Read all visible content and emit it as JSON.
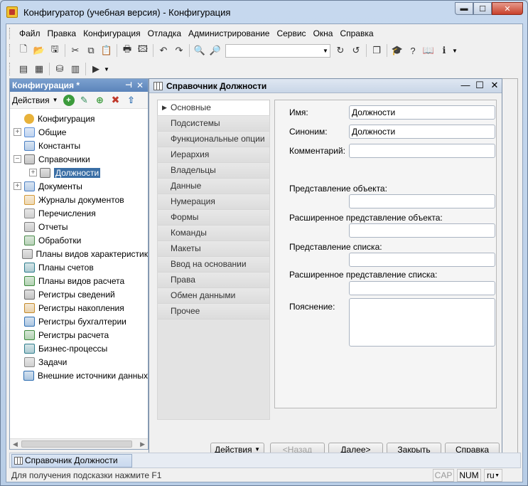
{
  "window": {
    "title": "Конфигуратор (учебная версия) - Конфигурация",
    "min_label": "▬",
    "max_label": "☐",
    "close_label": "✕"
  },
  "menu": [
    {
      "label": "Файл"
    },
    {
      "label": "Правка"
    },
    {
      "label": "Конфигурация"
    },
    {
      "label": "Отладка"
    },
    {
      "label": "Администрирование"
    },
    {
      "label": "Сервис"
    },
    {
      "label": "Окна"
    },
    {
      "label": "Справка"
    }
  ],
  "toolbar1": {
    "buttons": [
      {
        "name": "new-document-icon",
        "glyph": "🗋"
      },
      {
        "name": "open-folder-icon",
        "glyph": "📂"
      },
      {
        "name": "save-icon",
        "glyph": "🖫"
      },
      {
        "name": "cut-icon",
        "glyph": "✂"
      },
      {
        "name": "copy-icon",
        "glyph": "⧉"
      },
      {
        "name": "paste-icon",
        "glyph": "📋"
      },
      {
        "name": "print-icon",
        "glyph": "🖶"
      },
      {
        "name": "print-preview-icon",
        "glyph": "🖾"
      },
      {
        "name": "undo-icon",
        "glyph": "↶"
      },
      {
        "name": "redo-icon",
        "glyph": "↷"
      },
      {
        "name": "find-in-file-icon",
        "glyph": "🔍"
      },
      {
        "name": "search-icon",
        "glyph": "🔎"
      }
    ],
    "search_value": "",
    "buttons_after": [
      {
        "name": "find-next-icon",
        "glyph": "↻"
      },
      {
        "name": "find-prev-icon",
        "glyph": "↺"
      },
      {
        "name": "window-list-icon",
        "glyph": "❐"
      },
      {
        "name": "syntax-helper-icon",
        "glyph": "🎓"
      },
      {
        "name": "help-search-icon",
        "glyph": "?"
      },
      {
        "name": "help-book-icon",
        "glyph": "📖"
      },
      {
        "name": "info-icon",
        "glyph": "ℹ"
      }
    ]
  },
  "toolbar2": {
    "buttons": [
      {
        "name": "config-open-icon",
        "glyph": "▤"
      },
      {
        "name": "compare-icon",
        "glyph": "▦"
      },
      {
        "name": "database-update-icon",
        "glyph": "⛁"
      },
      {
        "name": "table-icon",
        "glyph": "▥"
      },
      {
        "name": "run-debug-icon",
        "glyph": "▶"
      }
    ]
  },
  "left_panel": {
    "title": "Конфигурация *",
    "pin_label": "⊣",
    "close_label": "✕",
    "actions_label": "Действия",
    "tree": [
      {
        "label": "Конфигурация",
        "expander": "",
        "indent": 0,
        "icon": "configuration-icon",
        "selected": false
      },
      {
        "label": "Общие",
        "expander": "+",
        "indent": 0,
        "icon": "common-icon",
        "selected": false
      },
      {
        "label": "Константы",
        "expander": "",
        "indent": 0,
        "icon": "constants-icon",
        "selected": false
      },
      {
        "label": "Справочники",
        "expander": "−",
        "indent": 0,
        "icon": "catalogs-icon",
        "selected": false
      },
      {
        "label": "Должности",
        "expander": "+",
        "indent": 1,
        "icon": "catalog-icon",
        "selected": true
      },
      {
        "label": "Документы",
        "expander": "+",
        "indent": 0,
        "icon": "documents-icon",
        "selected": false
      },
      {
        "label": "Журналы документов",
        "expander": "",
        "indent": 0,
        "icon": "journals-icon",
        "selected": false
      },
      {
        "label": "Перечисления",
        "expander": "",
        "indent": 0,
        "icon": "enums-icon",
        "selected": false
      },
      {
        "label": "Отчеты",
        "expander": "",
        "indent": 0,
        "icon": "reports-icon",
        "selected": false
      },
      {
        "label": "Обработки",
        "expander": "",
        "indent": 0,
        "icon": "processing-icon",
        "selected": false
      },
      {
        "label": "Планы видов характеристик",
        "expander": "",
        "indent": 0,
        "icon": "chart-of-characteristics-icon",
        "selected": false
      },
      {
        "label": "Планы счетов",
        "expander": "",
        "indent": 0,
        "icon": "chart-of-accounts-icon",
        "selected": false
      },
      {
        "label": "Планы видов расчета",
        "expander": "",
        "indent": 0,
        "icon": "chart-of-calculation-icon",
        "selected": false
      },
      {
        "label": "Регистры сведений",
        "expander": "",
        "indent": 0,
        "icon": "info-registers-icon",
        "selected": false
      },
      {
        "label": "Регистры накопления",
        "expander": "",
        "indent": 0,
        "icon": "accumulation-registers-icon",
        "selected": false
      },
      {
        "label": "Регистры бухгалтерии",
        "expander": "",
        "indent": 0,
        "icon": "accounting-registers-icon",
        "selected": false
      },
      {
        "label": "Регистры расчета",
        "expander": "",
        "indent": 0,
        "icon": "calculation-registers-icon",
        "selected": false
      },
      {
        "label": "Бизнес-процессы",
        "expander": "",
        "indent": 0,
        "icon": "business-processes-icon",
        "selected": false
      },
      {
        "label": "Задачи",
        "expander": "",
        "indent": 0,
        "icon": "tasks-icon",
        "selected": false
      },
      {
        "label": "Внешние источники данных",
        "expander": "",
        "indent": 0,
        "icon": "external-data-sources-icon",
        "selected": false
      }
    ]
  },
  "form": {
    "title": "Справочник Должности",
    "tabs": [
      {
        "label": "Основные",
        "active": true
      },
      {
        "label": "Подсистемы",
        "active": false
      },
      {
        "label": "Функциональные опции",
        "active": false
      },
      {
        "label": "Иерархия",
        "active": false
      },
      {
        "label": "Владельцы",
        "active": false
      },
      {
        "label": "Данные",
        "active": false
      },
      {
        "label": "Нумерация",
        "active": false
      },
      {
        "label": "Формы",
        "active": false
      },
      {
        "label": "Команды",
        "active": false
      },
      {
        "label": "Макеты",
        "active": false
      },
      {
        "label": "Ввод на основании",
        "active": false
      },
      {
        "label": "Права",
        "active": false
      },
      {
        "label": "Обмен данными",
        "active": false
      },
      {
        "label": "Прочее",
        "active": false
      }
    ],
    "fields": {
      "name_label": "Имя:",
      "name_value": "Должности",
      "synonym_label": "Синоним:",
      "synonym_value": "Должности",
      "comment_label": "Комментарий:",
      "comment_value": "",
      "object_repr_label": "Представление объекта:",
      "object_repr_value": "",
      "ext_object_repr_label": "Расширенное представление объекта:",
      "ext_object_repr_value": "",
      "list_repr_label": "Представление списка:",
      "list_repr_value": "",
      "ext_list_repr_label": "Расширенное представление списка:",
      "ext_list_repr_value": "",
      "explanation_label": "Пояснение:",
      "explanation_value": ""
    },
    "buttons": {
      "actions": "Действия",
      "back": "<Назад",
      "next": "Далее>",
      "close": "Закрыть",
      "help": "Справка"
    }
  },
  "window_bar": {
    "tab_label": "Справочник Должности"
  },
  "status": {
    "hint": "Для получения подсказки нажмите F1",
    "cap": "CAP",
    "num": "NUM",
    "lang": "ru"
  }
}
